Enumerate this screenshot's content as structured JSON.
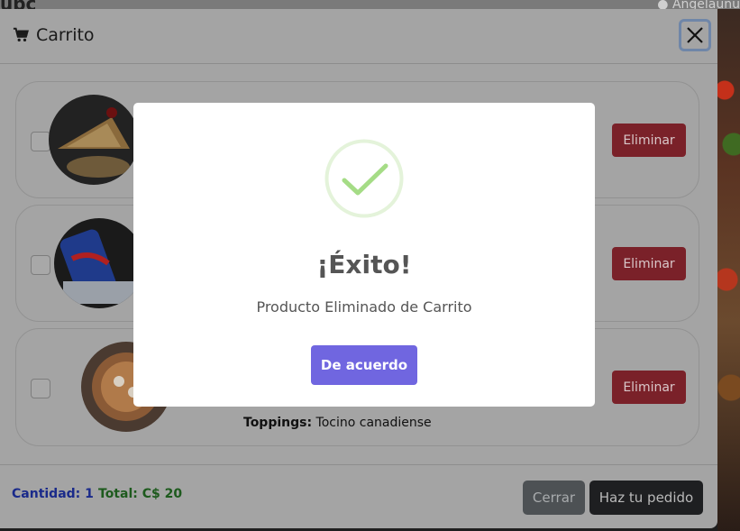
{
  "background": {
    "brand": "ubc",
    "user": "Angelaunu"
  },
  "cart": {
    "title": "Carrito",
    "items": [
      {
        "image": "pizza-slice",
        "delete_label": "Eliminar",
        "toppings_label": "",
        "toppings_value": ""
      },
      {
        "image": "soda-can",
        "delete_label": "Eliminar",
        "toppings_label": "",
        "toppings_value": ""
      },
      {
        "image": "pizza-bowl",
        "delete_label": "Eliminar",
        "toppings_label": "Toppings:",
        "toppings_value": "Tocino canadiense"
      }
    ],
    "footer": {
      "quantity": "Cantidad: 1",
      "total": "Total: C$ 20",
      "close_label": "Cerrar",
      "order_label": "Haz tu pedido"
    }
  },
  "dialog": {
    "title": "¡Éxito!",
    "message": "Producto Eliminado de Carrito",
    "confirm_label": "De acuerdo",
    "accent": "#7066e0",
    "check_color": "#a5dc86"
  }
}
